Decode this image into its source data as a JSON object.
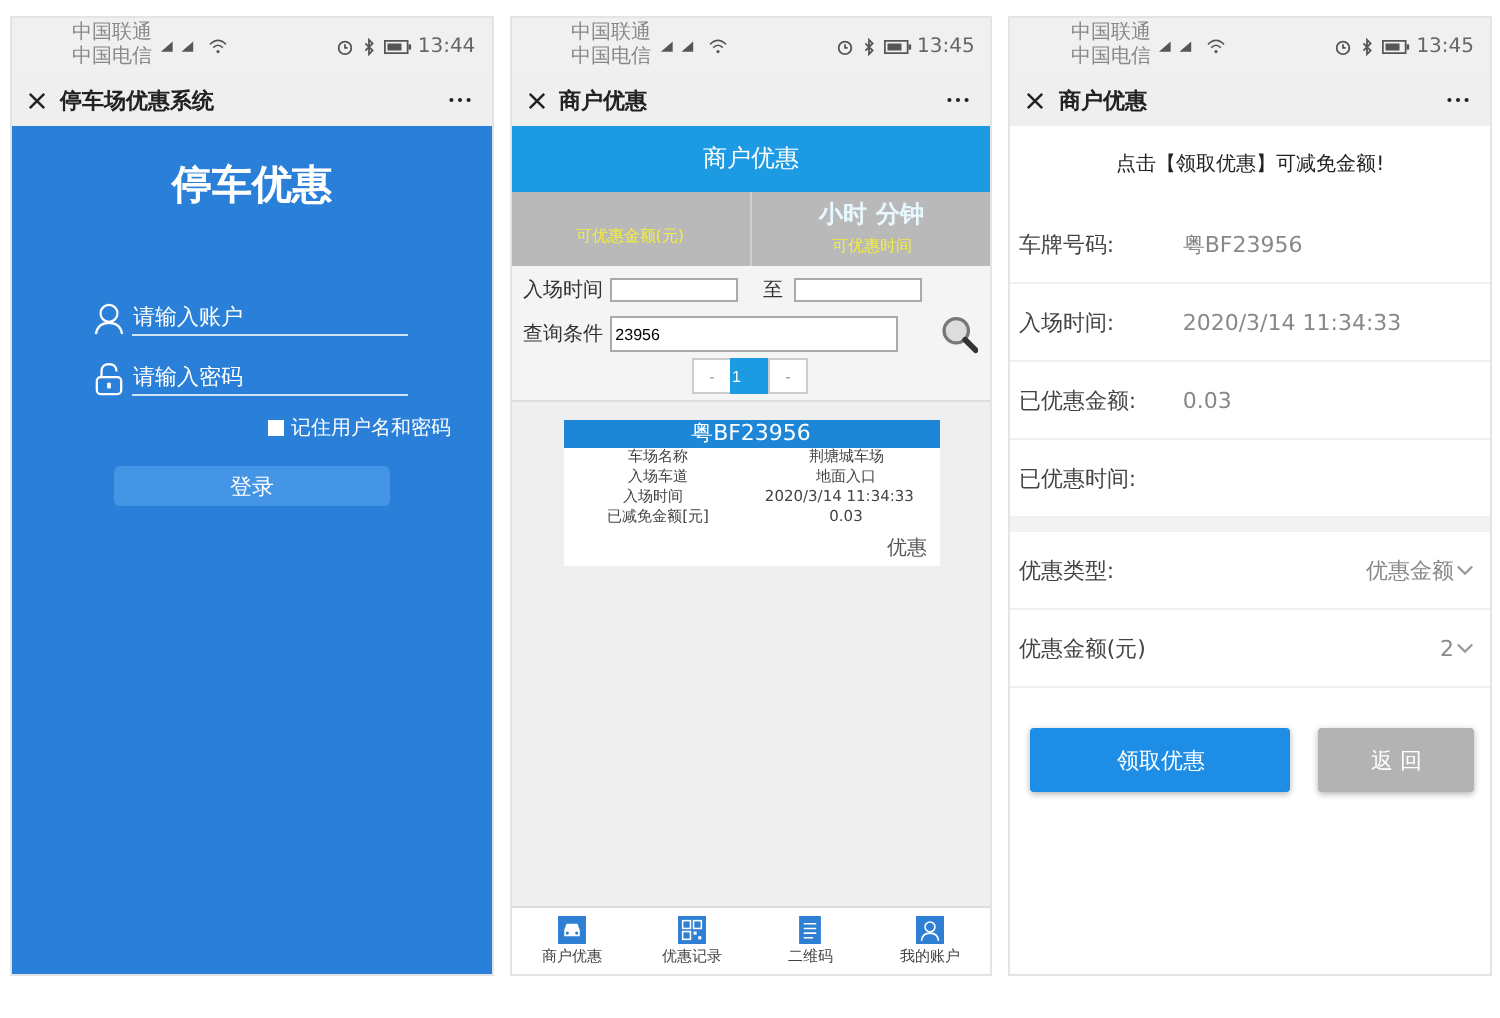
{
  "phones": [
    {
      "kind": "login",
      "status_bar": {
        "carriers": [
          "中国联通",
          "中国电信"
        ],
        "time": "13:44"
      },
      "title": "停车场优惠系统",
      "heading": "停车优惠",
      "fields": [
        {
          "kind": "user",
          "placeholder": "请输入账户"
        },
        {
          "kind": "lock",
          "placeholder": "请输入密码"
        }
      ],
      "remember": {
        "label": "记住用户名和密码",
        "checked": false
      },
      "login_button": "登录"
    },
    {
      "kind": "merchant",
      "status_bar": {
        "carriers": [
          "中国联通",
          "中国电信"
        ],
        "time": "13:45"
      },
      "title": "商户优惠",
      "header": "商户优惠",
      "summary": [
        {
          "label": "可优惠金额(元)"
        },
        {
          "value": "小时 分钟",
          "label": "可优惠时间"
        }
      ],
      "filters": {
        "entry_label": "入场时间",
        "to_label": "至",
        "query_label": "查询条件",
        "query_value": "23956"
      },
      "pagination": [
        {
          "label": "-",
          "selected": false
        },
        {
          "label": "1",
          "selected": true
        },
        {
          "label": "-",
          "selected": false
        }
      ],
      "record": {
        "plate": "粤BF23956",
        "rows": [
          {
            "label": "车场名称",
            "value": "荆塘城车场"
          },
          {
            "label": "入场车道",
            "value": "地面入口"
          },
          {
            "label": "入场时间",
            "value": "2020/3/14 11:34:33"
          },
          {
            "label": "已减免金额[元]",
            "value": "0.03"
          }
        ],
        "action": "优惠"
      },
      "nav": [
        {
          "kind": "car",
          "label": "商户优惠"
        },
        {
          "kind": "qr",
          "label": "优惠记录"
        },
        {
          "kind": "doc",
          "label": "二维码"
        },
        {
          "kind": "user",
          "label": "我的账户"
        }
      ]
    },
    {
      "kind": "claim",
      "status_bar": {
        "carriers": [
          "中国联通",
          "中国电信"
        ],
        "time": "13:45"
      },
      "title": "商户优惠",
      "notice": "点击【领取优惠】可减免金额!",
      "info_rows": [
        {
          "label": "车牌号码:",
          "value": "粤BF23956"
        },
        {
          "label": "入场时间:",
          "value": "2020/3/14 11:34:33"
        },
        {
          "label": "已优惠金额:",
          "value": "0.03"
        },
        {
          "label": "已优惠时间:"
        }
      ],
      "select_rows": [
        {
          "label": "优惠类型:",
          "value": "优惠金额"
        },
        {
          "label": "优惠金额(元)",
          "value": "2"
        }
      ],
      "buttons": [
        {
          "kind": "primary",
          "label": "领取优惠"
        },
        {
          "kind": "secondary",
          "label": "返 回"
        }
      ]
    }
  ]
}
